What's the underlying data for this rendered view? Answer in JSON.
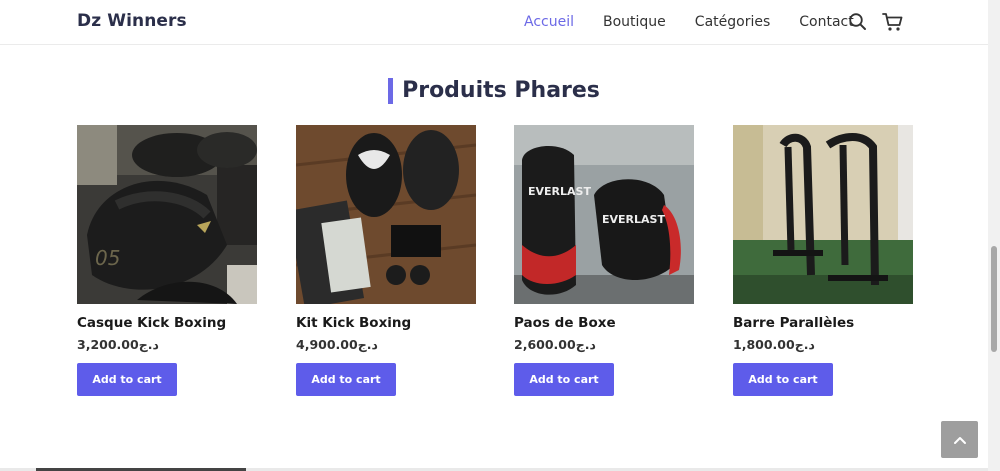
{
  "header": {
    "logo": "Dz Winners",
    "nav": [
      "Accueil",
      "Boutique",
      "Catégories",
      "Contact"
    ],
    "active_nav": "Accueil",
    "icons": [
      "search-icon",
      "cart-icon"
    ]
  },
  "section": {
    "title": "Produits Phares"
  },
  "products": [
    {
      "name": "Casque Kick Boxing",
      "price": "د.ج3,200.00",
      "button": "Add to cart"
    },
    {
      "name": "Kit Kick Boxing",
      "price": "د.ج4,900.00",
      "button": "Add to cart"
    },
    {
      "name": "Paos de Boxe",
      "price": "د.ج2,600.00",
      "button": "Add to cart"
    },
    {
      "name": "Barre Parallèles",
      "price": "د.ج1,800.00",
      "button": "Add to cart"
    }
  ],
  "colors": {
    "accent": "#5e5cea",
    "active_link": "#6c69e6",
    "title": "#2b2f4a"
  }
}
